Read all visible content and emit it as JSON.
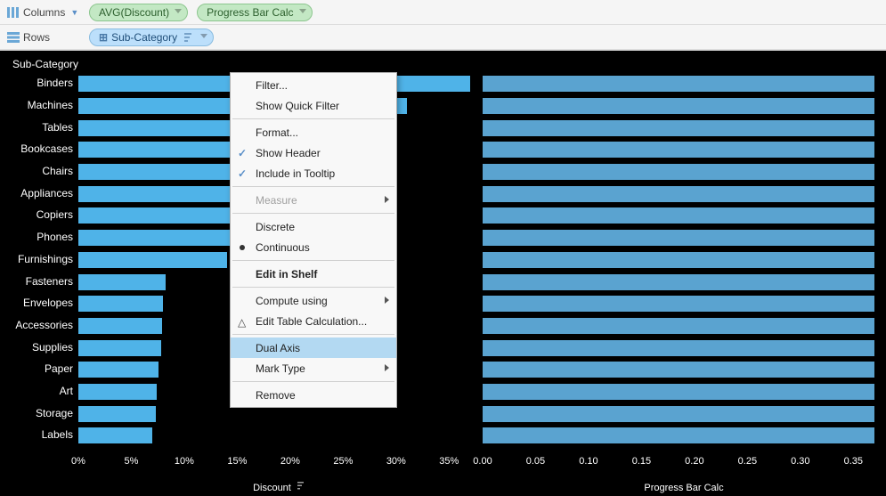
{
  "shelves": {
    "columns_label": "Columns",
    "rows_label": "Rows",
    "pills": {
      "avg_discount": "AVG(Discount)",
      "progress_bar_calc": "Progress Bar Calc",
      "sub_category": "Sub-Category"
    }
  },
  "context_menu": {
    "filter": "Filter...",
    "show_quick_filter": "Show Quick Filter",
    "format": "Format...",
    "show_header": "Show Header",
    "include_in_tooltip": "Include in Tooltip",
    "measure": "Measure",
    "discrete": "Discrete",
    "continuous": "Continuous",
    "edit_in_shelf": "Edit in Shelf",
    "compute_using": "Compute using",
    "edit_table_calc": "Edit Table Calculation...",
    "dual_axis": "Dual Axis",
    "mark_type": "Mark Type",
    "remove": "Remove"
  },
  "viz": {
    "header": "Sub-Category",
    "axis_left_label": "Discount",
    "axis_right_label": "Progress Bar Calc"
  },
  "chart_data": {
    "type": "bar",
    "categories": [
      "Binders",
      "Machines",
      "Tables",
      "Bookcases",
      "Chairs",
      "Appliances",
      "Copiers",
      "Phones",
      "Furnishings",
      "Fasteners",
      "Envelopes",
      "Accessories",
      "Supplies",
      "Paper",
      "Art",
      "Storage",
      "Labels"
    ],
    "series": [
      {
        "name": "Discount",
        "values": [
          0.37,
          0.31,
          0.262,
          0.212,
          0.17,
          0.168,
          0.162,
          0.155,
          0.14,
          0.082,
          0.08,
          0.079,
          0.078,
          0.076,
          0.074,
          0.073,
          0.07
        ],
        "axis": {
          "min": 0,
          "max": 0.38,
          "ticks": [
            0,
            0.05,
            0.1,
            0.15,
            0.2,
            0.25,
            0.3,
            0.35
          ],
          "tick_labels": [
            "0%",
            "5%",
            "10%",
            "15%",
            "20%",
            "25%",
            "30%",
            "35%"
          ]
        },
        "color": "#4fb3e8"
      },
      {
        "name": "Progress Bar Calc",
        "values": [
          0.37,
          0.37,
          0.37,
          0.37,
          0.37,
          0.37,
          0.37,
          0.37,
          0.37,
          0.37,
          0.37,
          0.37,
          0.37,
          0.37,
          0.37,
          0.37,
          0.37
        ],
        "axis": {
          "min": 0,
          "max": 0.38,
          "ticks": [
            0,
            0.05,
            0.1,
            0.15,
            0.2,
            0.25,
            0.3,
            0.35
          ],
          "tick_labels": [
            "0.00",
            "0.05",
            "0.10",
            "0.15",
            "0.20",
            "0.25",
            "0.30",
            "0.35"
          ]
        },
        "color": "#5aa3d0"
      }
    ]
  }
}
